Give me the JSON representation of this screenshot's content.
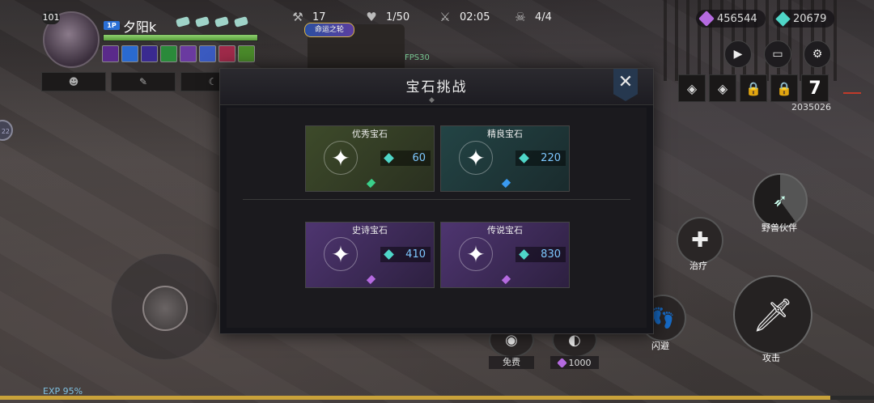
{
  "player": {
    "level": "101",
    "badge": "1P",
    "name": "夕阳k",
    "hp_fraction": 1.0
  },
  "skill_slots": [
    "☻",
    "✎",
    "☾"
  ],
  "stats": {
    "resource": "17",
    "monsters": "1/50",
    "time": "02:05",
    "kills": "4/4"
  },
  "event_badge": "命运之轮",
  "fps": "FPS30",
  "currency": {
    "purple": "456544",
    "crystal": "20679"
  },
  "right_buttons": {
    "play": "▶",
    "screen": "▭",
    "settings": "⚙"
  },
  "right_slots": {
    "slot1": "◈",
    "slot2": "◈",
    "lock1": "🔒",
    "lock2": "🔒",
    "number": "7"
  },
  "score": "2035026",
  "side_badge": "22",
  "modal": {
    "title": "宝石挑战",
    "close": "✕",
    "cards": [
      {
        "name": "优秀宝石",
        "price": "60",
        "tier": "green"
      },
      {
        "name": "精良宝石",
        "price": "220",
        "tier": "blue"
      },
      {
        "name": "史诗宝石",
        "price": "410",
        "tier": "purple"
      },
      {
        "name": "传说宝石",
        "price": "830",
        "tier": "purple"
      }
    ]
  },
  "actions": {
    "pet_label": "野兽伙伴",
    "heal_label": "治疗",
    "dodge_label": "闪避",
    "attack_label": "攻击",
    "free_label": "免费",
    "skill_cost": "1000"
  },
  "exp": {
    "label": "EXP 95%",
    "fraction": 0.95
  },
  "colors": {
    "accent_gold": "#c9a23a",
    "gem_purple": "#b56ae0",
    "gem_crystal": "#4fd6c8",
    "price_blue": "#7ec8ff"
  }
}
